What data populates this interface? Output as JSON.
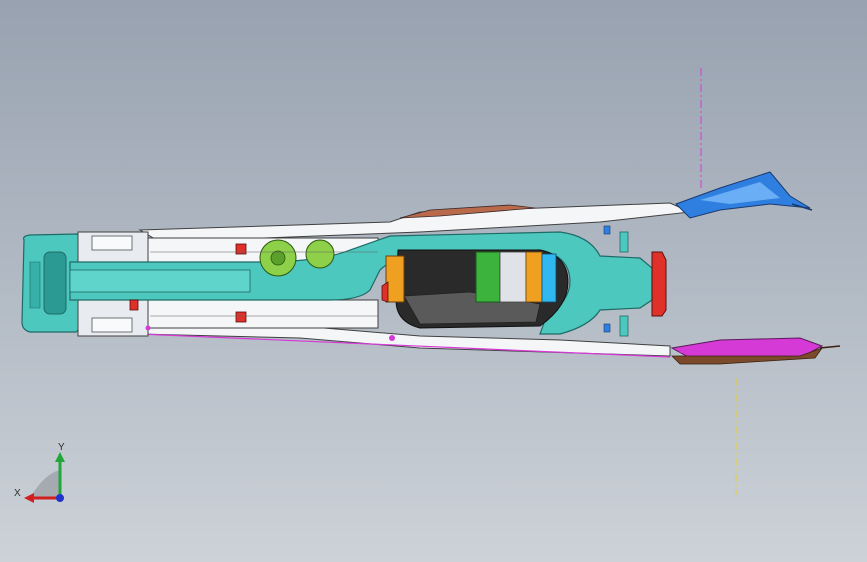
{
  "view": {
    "background_top": "#98a2b0",
    "background_bottom": "#cdd2d8"
  },
  "triad": {
    "x_label": "X",
    "y_label": "Y",
    "x_color": "#d21f1f",
    "y_color": "#22a63a",
    "z_color": "#2233cc"
  },
  "colors": {
    "teal": "#4cc8bf",
    "teal_dark": "#2a9a92",
    "blue": "#2f7fe0",
    "magenta": "#d63ad6",
    "red": "#e0302a",
    "orange": "#f0a020",
    "green": "#3cb33c",
    "lime": "#8ed04a",
    "cyan": "#30b8f0",
    "dark": "#2a2a2a",
    "brown": "#7a4a2a",
    "white": "#f4f6f8"
  }
}
